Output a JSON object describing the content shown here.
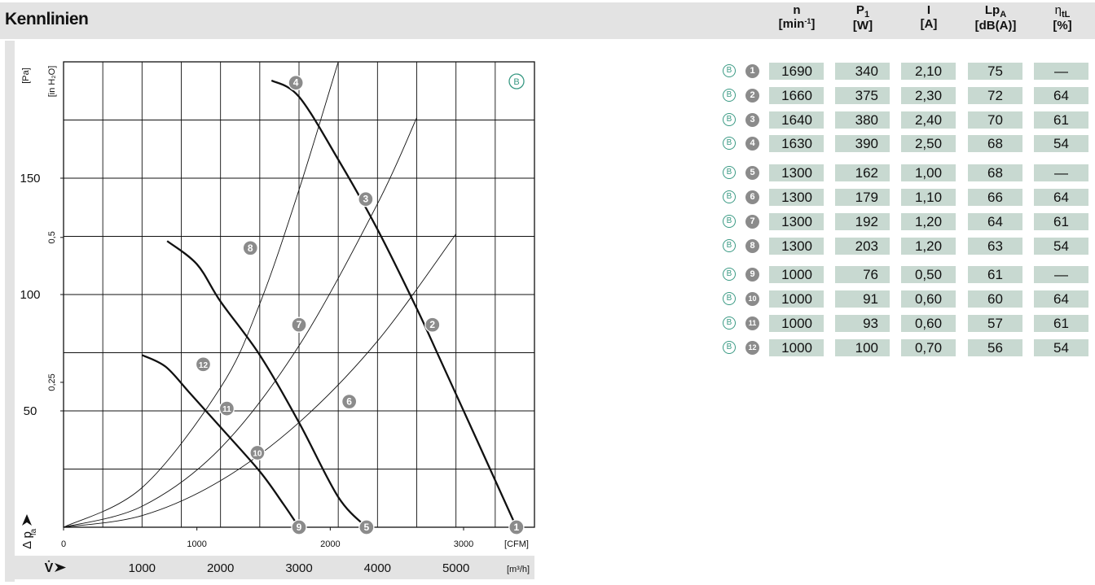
{
  "header": {
    "title": "Kennlinien"
  },
  "table": {
    "columns": [
      {
        "symbol": "n",
        "sub": "",
        "unit_a": "[min",
        "unit_sup": "-1",
        "unit_b": "]"
      },
      {
        "symbol": "P",
        "sub": "1",
        "unit_a": "[W]",
        "unit_sup": "",
        "unit_b": ""
      },
      {
        "symbol": "I",
        "sub": "",
        "unit_a": "[A]",
        "unit_sup": "",
        "unit_b": ""
      },
      {
        "symbol": "Lp",
        "sub": "A",
        "unit_a": "[dB(A)]",
        "unit_sup": "",
        "unit_b": ""
      },
      {
        "symbol": "η",
        "sub": "tL",
        "unit_a": "[%]",
        "unit_sup": "",
        "unit_b": ""
      }
    ],
    "rows": [
      {
        "badge": "B",
        "num": "1",
        "n": "1690",
        "p1": "340",
        "i": "2,10",
        "lpa": "75",
        "eta": "—"
      },
      {
        "badge": "B",
        "num": "2",
        "n": "1660",
        "p1": "375",
        "i": "2,30",
        "lpa": "72",
        "eta": "64"
      },
      {
        "badge": "B",
        "num": "3",
        "n": "1640",
        "p1": "380",
        "i": "2,40",
        "lpa": "70",
        "eta": "61"
      },
      {
        "badge": "B",
        "num": "4",
        "n": "1630",
        "p1": "390",
        "i": "2,50",
        "lpa": "68",
        "eta": "54"
      },
      {
        "badge": "B",
        "num": "5",
        "n": "1300",
        "p1": "162",
        "i": "1,00",
        "lpa": "68",
        "eta": "—"
      },
      {
        "badge": "B",
        "num": "6",
        "n": "1300",
        "p1": "179",
        "i": "1,10",
        "lpa": "66",
        "eta": "64"
      },
      {
        "badge": "B",
        "num": "7",
        "n": "1300",
        "p1": "192",
        "i": "1,20",
        "lpa": "64",
        "eta": "61"
      },
      {
        "badge": "B",
        "num": "8",
        "n": "1300",
        "p1": "203",
        "i": "1,20",
        "lpa": "63",
        "eta": "54"
      },
      {
        "badge": "B",
        "num": "9",
        "n": "1000",
        "p1": "76",
        "i": "0,50",
        "lpa": "61",
        "eta": "—"
      },
      {
        "badge": "B",
        "num": "10",
        "n": "1000",
        "p1": "91",
        "i": "0,60",
        "lpa": "60",
        "eta": "64"
      },
      {
        "badge": "B",
        "num": "11",
        "n": "1000",
        "p1": "93",
        "i": "0,60",
        "lpa": "57",
        "eta": "61"
      },
      {
        "badge": "B",
        "num": "12",
        "n": "1000",
        "p1": "100",
        "i": "0,70",
        "lpa": "56",
        "eta": "54"
      }
    ]
  },
  "chart_data": {
    "type": "line",
    "corner_badge": "B",
    "xlim": [
      0,
      6000
    ],
    "ylim": [
      0,
      200
    ],
    "grid": true,
    "x_axis_m3h": {
      "unit": "[m³/h]",
      "ticks": [
        1000,
        2000,
        3000,
        4000,
        5000
      ],
      "labels": [
        "1000",
        "2000",
        "3000",
        "4000",
        "5000"
      ],
      "symbol": "V̇"
    },
    "x_axis_cfm": {
      "unit": "[CFM]",
      "ticks": [
        0,
        1000,
        2000,
        3000
      ],
      "labels": [
        "0",
        "1000",
        "2000",
        "3000"
      ]
    },
    "y_axis_pa": {
      "unit": "[Pa]",
      "ticks": [
        50,
        100,
        150
      ],
      "labels": [
        "50",
        "100",
        "150"
      ],
      "symbol": "Δ p",
      "symbol_sub": "fa"
    },
    "y_axis_inh2o": {
      "unit": "[in H₂O]",
      "ticks": [
        0.25,
        0.5
      ],
      "labels": [
        "0,25",
        "0,5"
      ]
    },
    "series": [
      {
        "id": "n1",
        "points": [
          [
            2650,
            192
          ],
          [
            3000,
            185
          ],
          [
            3500,
            158
          ],
          [
            4000,
            128
          ],
          [
            4500,
            94
          ],
          [
            4800,
            72
          ],
          [
            5300,
            35
          ],
          [
            5770,
            0
          ]
        ]
      },
      {
        "id": "n2",
        "points": [
          [
            1320,
            123
          ],
          [
            1700,
            113
          ],
          [
            2000,
            97
          ],
          [
            2500,
            74
          ],
          [
            3000,
            45
          ],
          [
            3500,
            13
          ],
          [
            3860,
            0
          ]
        ]
      },
      {
        "id": "n3",
        "points": [
          [
            1000,
            74
          ],
          [
            1300,
            69
          ],
          [
            1600,
            58
          ],
          [
            2000,
            43
          ],
          [
            2500,
            24
          ],
          [
            2800,
            10
          ],
          [
            3000,
            0
          ]
        ]
      }
    ],
    "system_curves": [
      {
        "id": "s1",
        "points": [
          [
            0,
            0
          ],
          [
            1000,
            17
          ],
          [
            2000,
            60
          ],
          [
            2500,
            96
          ],
          [
            3000,
            145
          ],
          [
            3500,
            200
          ]
        ]
      },
      {
        "id": "s2",
        "points": [
          [
            0,
            0
          ],
          [
            1000,
            9
          ],
          [
            2000,
            34
          ],
          [
            3000,
            78
          ],
          [
            4000,
            139
          ],
          [
            4500,
            176
          ]
        ]
      },
      {
        "id": "s3",
        "points": [
          [
            0,
            0
          ],
          [
            1000,
            5
          ],
          [
            2000,
            20
          ],
          [
            3000,
            45
          ],
          [
            4000,
            80
          ],
          [
            5000,
            126
          ]
        ]
      }
    ],
    "markers": [
      {
        "label": "1",
        "x": 5770,
        "y": 0
      },
      {
        "label": "2",
        "x": 4700,
        "y": 87
      },
      {
        "label": "3",
        "x": 3850,
        "y": 141
      },
      {
        "label": "4",
        "x": 2960,
        "y": 191
      },
      {
        "label": "5",
        "x": 3860,
        "y": 0
      },
      {
        "label": "6",
        "x": 3640,
        "y": 54
      },
      {
        "label": "7",
        "x": 3000,
        "y": 87
      },
      {
        "label": "8",
        "x": 2380,
        "y": 120
      },
      {
        "label": "9",
        "x": 3000,
        "y": 0
      },
      {
        "label": "10",
        "x": 2470,
        "y": 32
      },
      {
        "label": "11",
        "x": 2080,
        "y": 51
      },
      {
        "label": "12",
        "x": 1780,
        "y": 70
      }
    ]
  },
  "colors": {
    "header_bg": "#e3e3e3",
    "cell_bg": "#c8d9d1",
    "accent_teal": "#3a9a84",
    "marker_gray": "#8b8b8b"
  }
}
